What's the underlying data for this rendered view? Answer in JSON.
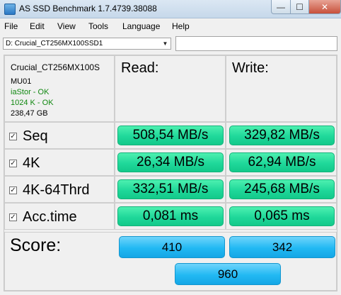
{
  "window": {
    "title": "AS SSD Benchmark 1.7.4739.38088",
    "controls": {
      "minimize": "—",
      "maximize": "☐",
      "close": "✕"
    }
  },
  "menu": [
    "File",
    "Edit",
    "View",
    "Tools",
    "Language",
    "Help"
  ],
  "drive_select": {
    "value": "D: Crucial_CT256MX100SSD1"
  },
  "drive_info": {
    "name": "Crucial_CT256MX100S",
    "firmware": "MU01",
    "driver": "iaStor - OK",
    "alignment": "1024 K - OK",
    "size": "238,47 GB"
  },
  "columns": {
    "read": "Read:",
    "write": "Write:"
  },
  "rows": [
    {
      "label": "Seq",
      "checked": true,
      "read": "508,54 MB/s",
      "write": "329,82 MB/s"
    },
    {
      "label": "4K",
      "checked": true,
      "read": "26,34 MB/s",
      "write": "62,94 MB/s"
    },
    {
      "label": "4K-64Thrd",
      "checked": true,
      "read": "332,51 MB/s",
      "write": "245,68 MB/s"
    },
    {
      "label": "Acc.time",
      "checked": true,
      "read": "0,081 ms",
      "write": "0,065 ms"
    }
  ],
  "score": {
    "label": "Score:",
    "read": "410",
    "write": "342",
    "total": "960"
  },
  "colors": {
    "ok_text": "#118811",
    "value_green": "#1fd89a",
    "score_blue": "#22b9f3"
  },
  "check_glyph": "☑"
}
